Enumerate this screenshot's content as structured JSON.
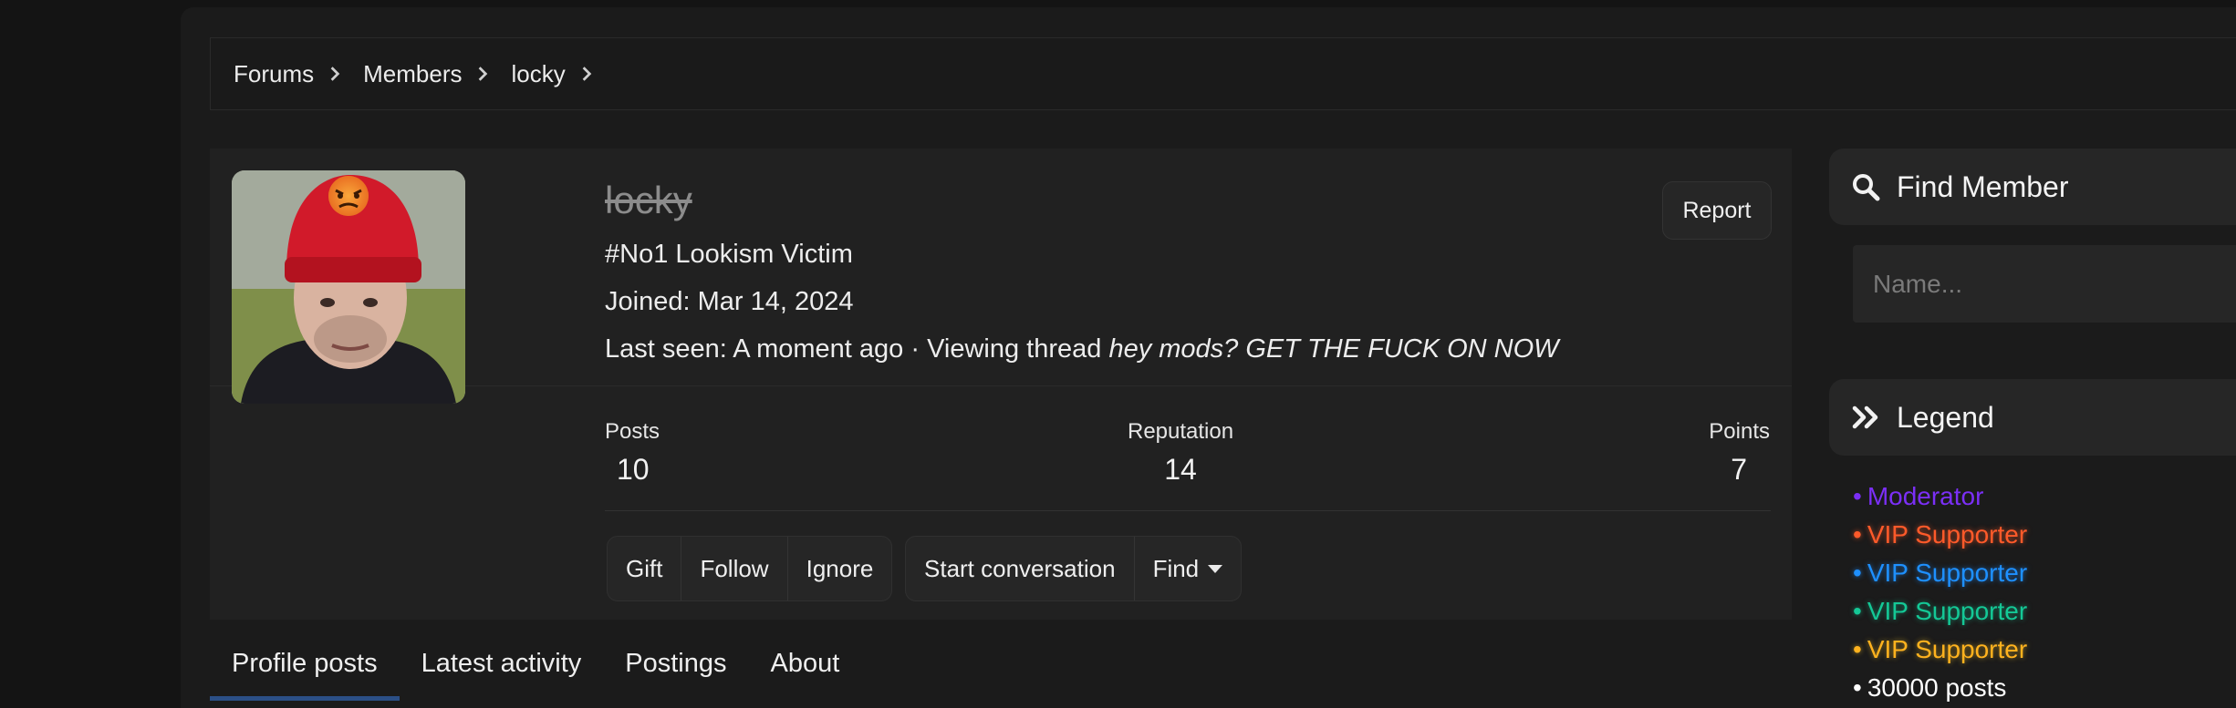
{
  "breadcrumb": {
    "items": [
      "Forums",
      "Members",
      "locky"
    ]
  },
  "profile": {
    "username": "locky",
    "custom_title": "#No1 Lookism Victim",
    "joined_label": "Joined:",
    "joined_value": "Mar 14, 2024",
    "last_seen_label": "Last seen:",
    "last_seen_text": "A moment ago · Viewing thread",
    "last_seen_thread": "hey mods? GET THE FUCK ON NOW",
    "report_label": "Report",
    "stats": {
      "posts_label": "Posts",
      "posts_value": "10",
      "reputation_label": "Reputation",
      "reputation_value": "14",
      "points_label": "Points",
      "points_value": "7"
    },
    "actions_group_1": [
      "Gift",
      "Follow",
      "Ignore"
    ],
    "actions_group_2": {
      "start_conversation": "Start conversation",
      "find": "Find"
    }
  },
  "tabs": [
    "Profile posts",
    "Latest activity",
    "Postings",
    "About"
  ],
  "active_tab": "Profile posts",
  "sidebar": {
    "find_member_title": "Find Member",
    "name_placeholder": "Name...",
    "legend_title": "Legend",
    "legend_items": [
      {
        "label": "Moderator",
        "color": "#7b2ff7"
      },
      {
        "label": "VIP Supporter",
        "color": "#ff5a2a"
      },
      {
        "label": "VIP Supporter",
        "color": "#1e90ff"
      },
      {
        "label": "VIP Supporter",
        "color": "#14c896"
      },
      {
        "label": "VIP Supporter",
        "color": "#ffb21e"
      },
      {
        "label": "30000 posts",
        "color": "#ffffff"
      }
    ]
  },
  "colors": {
    "background": "#141414",
    "panel": "#212121",
    "tab_active_underline": "#2b4f86"
  }
}
